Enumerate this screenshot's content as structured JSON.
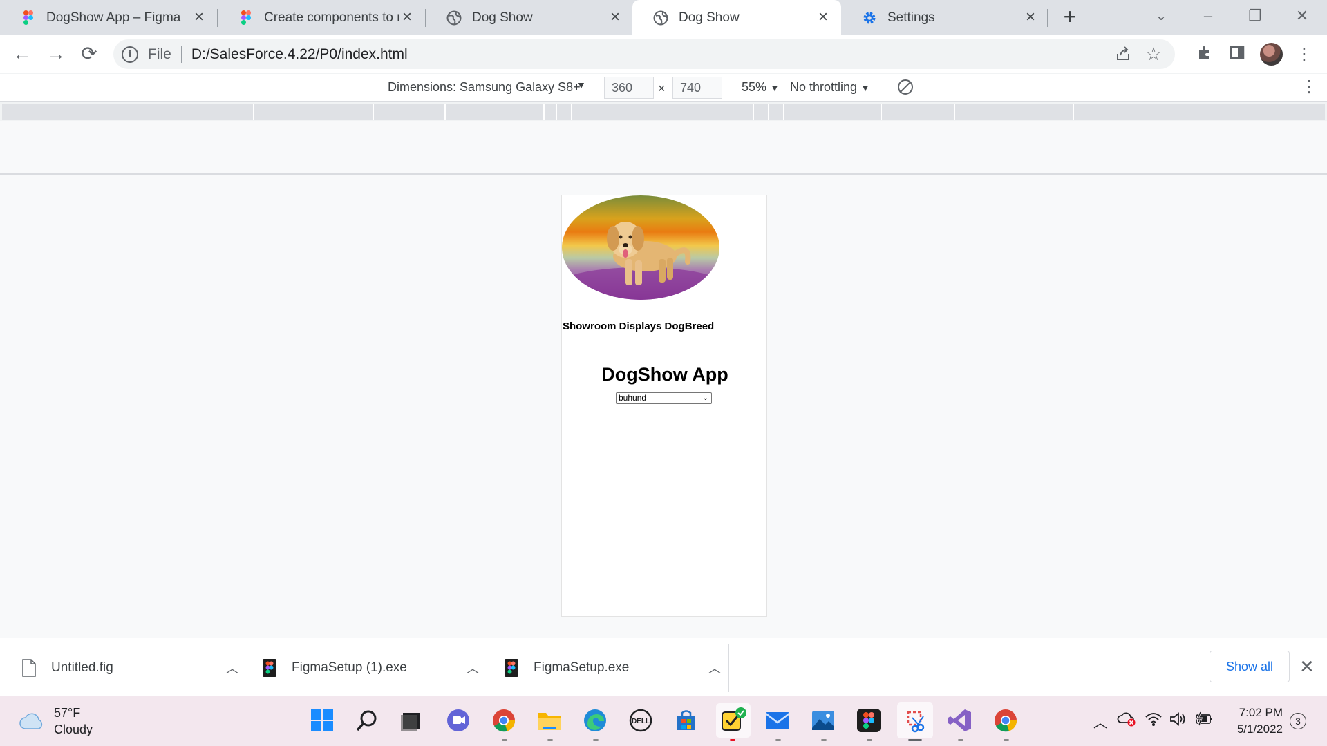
{
  "browser": {
    "tabs": [
      {
        "title": "DogShow App – Figma",
        "icon": "figma-icon"
      },
      {
        "title": "Create components to reu",
        "icon": "figma-icon"
      },
      {
        "title": "Dog Show",
        "icon": "globe-icon"
      },
      {
        "title": "Dog Show",
        "icon": "globe-icon",
        "active": true
      },
      {
        "title": "Settings",
        "icon": "gear-icon"
      }
    ],
    "address": {
      "scheme": "File",
      "url": "D:/SalesForce.4.22/P0/index.html"
    }
  },
  "devtools": {
    "device_label": "Dimensions: Samsung Galaxy S8+",
    "width": "360",
    "height": "740",
    "x_sep": "×",
    "zoom": "55%",
    "throttle": "No throttling"
  },
  "page": {
    "caption": "Showroom Displays DogBreed",
    "title": "DogShow App",
    "select_value": "buhund"
  },
  "downloads": {
    "items": [
      {
        "name": "Untitled.fig",
        "icon": "file-icon"
      },
      {
        "name": "FigmaSetup (1).exe",
        "icon": "figma-icon"
      },
      {
        "name": "FigmaSetup.exe",
        "icon": "figma-icon"
      }
    ],
    "show_all": "Show all"
  },
  "taskbar": {
    "weather": {
      "temp": "57°F",
      "condition": "Cloudy"
    },
    "time": "7:02 PM",
    "date": "5/1/2022",
    "notifications": "3"
  },
  "colors": {
    "accent": "#1a73e8",
    "tab_strip": "#dee1e6",
    "taskbar": "#f3e7ee"
  }
}
